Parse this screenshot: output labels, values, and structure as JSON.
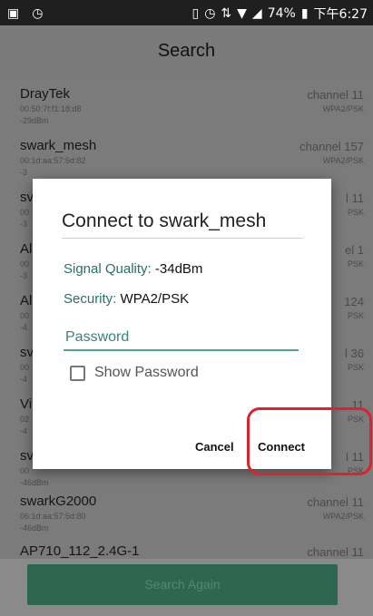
{
  "status_bar": {
    "icons": [
      "image-icon",
      "alarm-clock-icon",
      "vibrate-icon",
      "alarm-icon",
      "data-arrows-icon",
      "wifi-icon",
      "signal-icon",
      "battery-icon"
    ],
    "battery": "74%",
    "time": "下午6:27"
  },
  "header": {
    "title": "Search"
  },
  "networks": [
    {
      "ssid": "DrayTek",
      "mac": "00:50:7f:f1:18:d8",
      "dbm": "-29dBm",
      "channel": "channel 11",
      "security": "WPA2/PSK"
    },
    {
      "ssid": "swark_mesh",
      "mac": "00:1d:aa:57:5d:82",
      "dbm": "-3",
      "channel": "channel 157",
      "security": "WPA2/PSK"
    },
    {
      "ssid": "sv",
      "mac": "00",
      "dbm": "-3",
      "channel": "l 11",
      "security": "PSK"
    },
    {
      "ssid": "Al",
      "mac": "00",
      "dbm": "-3",
      "channel": "el 1",
      "security": "PSK"
    },
    {
      "ssid": "Al",
      "mac": "00",
      "dbm": "-4",
      "channel": "124",
      "security": "PSK"
    },
    {
      "ssid": "sv",
      "mac": "00",
      "dbm": "-4",
      "channel": "l 36",
      "security": "PSK"
    },
    {
      "ssid": "Vi",
      "mac": "02",
      "dbm": "-4",
      "channel": "11",
      "security": "PSK"
    },
    {
      "ssid": "sv",
      "mac": "00",
      "dbm": "-46dBm",
      "channel": "l 11",
      "security": "PSK"
    },
    {
      "ssid": "swarkG2000",
      "mac": "06:1d:aa:57:5d:80",
      "dbm": "-46dBm",
      "channel": "channel 11",
      "security": "WPA2/PSK"
    },
    {
      "ssid": "AP710_112_2.4G-1",
      "mac": "",
      "dbm": "",
      "channel": "channel 11",
      "security": ""
    }
  ],
  "bottom": {
    "search_again": "Search Again"
  },
  "dialog": {
    "title": "Connect to swark_mesh",
    "signal_label": "Signal Quality: ",
    "signal_value": "-34dBm",
    "security_label": "Security: ",
    "security_value": "WPA2/PSK",
    "password_placeholder": "Password",
    "show_password_label": "Show Password",
    "show_password_checked": false,
    "cancel_label": "Cancel",
    "connect_label": "Connect"
  },
  "colors": {
    "accent_teal": "#4ea795",
    "button_green": "#2f6650",
    "highlight_red": "#e0202a"
  }
}
